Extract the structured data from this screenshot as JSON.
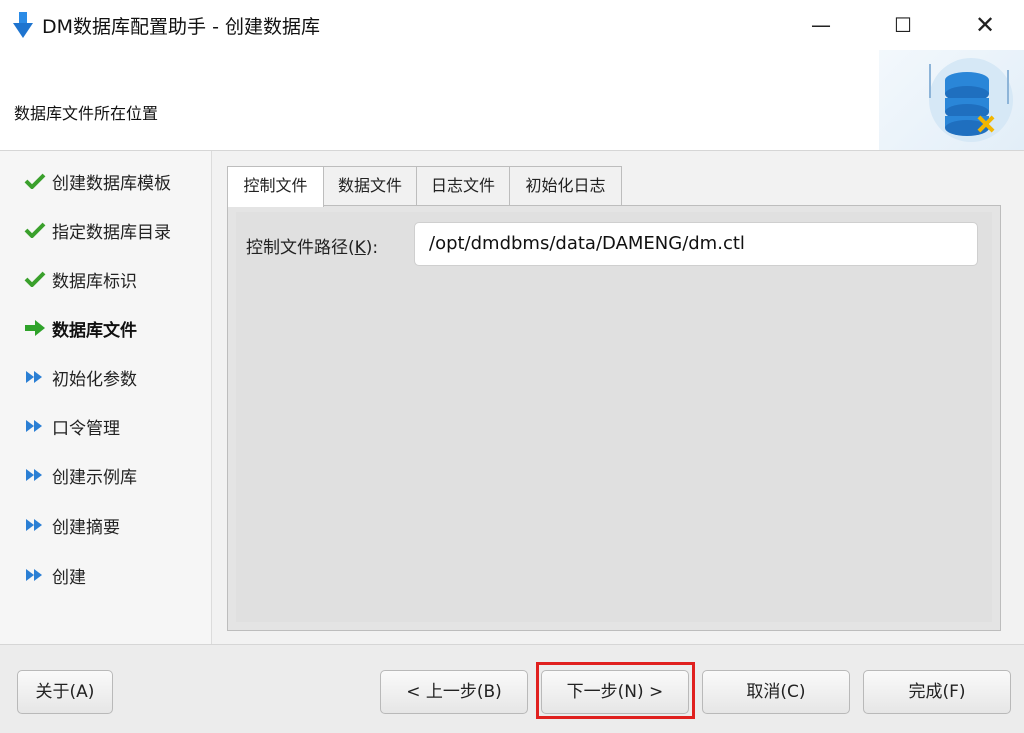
{
  "window": {
    "title": "DM数据库配置助手 - 创建数据库",
    "minimize_glyph": "—",
    "maximize_glyph": "☐",
    "close_glyph": "✕"
  },
  "header": {
    "subtitle": "数据库文件所在位置",
    "art_icon": "database-settings-icon"
  },
  "nav": {
    "items": [
      {
        "label": "创建数据库模板",
        "status": "done",
        "icon": "check-icon"
      },
      {
        "label": "指定数据库目录",
        "status": "done",
        "icon": "check-icon"
      },
      {
        "label": "数据库标识",
        "status": "done",
        "icon": "check-icon"
      },
      {
        "label": "数据库文件",
        "status": "current",
        "icon": "arrow-right-icon"
      },
      {
        "label": "初始化参数",
        "status": "pending",
        "icon": "double-arrow-icon"
      },
      {
        "label": "口令管理",
        "status": "pending",
        "icon": "double-arrow-icon"
      },
      {
        "label": "创建示例库",
        "status": "pending",
        "icon": "double-arrow-icon"
      },
      {
        "label": "创建摘要",
        "status": "pending",
        "icon": "double-arrow-icon"
      },
      {
        "label": "创建",
        "status": "pending",
        "icon": "double-arrow-icon"
      }
    ]
  },
  "tabs": [
    {
      "label": "控制文件",
      "active": true
    },
    {
      "label": "数据文件",
      "active": false
    },
    {
      "label": "日志文件",
      "active": false
    },
    {
      "label": "初始化日志",
      "active": false
    }
  ],
  "control_file": {
    "label_prefix": "控制文件路径(",
    "label_key": "K",
    "label_suffix": "):",
    "path_value": "/opt/dmdbms/data/DAMENG/dm.ctl"
  },
  "footer": {
    "about": "关于(A)",
    "prev": "< 上一步(B)",
    "next": "下一步(N) >",
    "cancel": "取消(C)",
    "finish": "完成(F)"
  },
  "colors": {
    "check": "#3aa02c",
    "current_arrow": "#2fa22a",
    "pending_arrow": "#2b7fd4",
    "highlight": "#e0201e"
  }
}
